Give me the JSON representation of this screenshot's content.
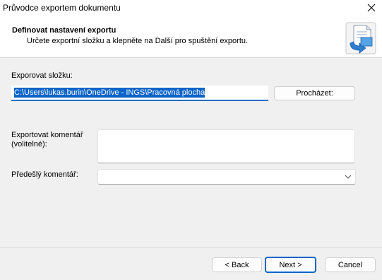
{
  "window": {
    "title": "Průvodce exportem dokumentu",
    "close_icon": "close-icon"
  },
  "header": {
    "title": "Definovat nastavení exportu",
    "subtitle": "Určete exportní složku a klepněte na Další pro spuštění exportu.",
    "icon": "export-document-icon"
  },
  "form": {
    "folder_label": "Exporovat složku:",
    "folder_value": "C:\\Users\\lukas.burin\\OneDrive - INGS\\Pracovná plocha",
    "browse_label": "Procházet:",
    "comment_label_line1": "Exportovat komentář",
    "comment_label_line2": "(volitelné):",
    "comment_value": "",
    "previous_comment_label": "Předešlý komentář:",
    "previous_comment_value": ""
  },
  "footer": {
    "back_label": "< Back",
    "next_label": "Next >",
    "cancel_label": "Cancel"
  },
  "colors": {
    "accent": "#0a64c8",
    "background": "#f0f0f0"
  }
}
